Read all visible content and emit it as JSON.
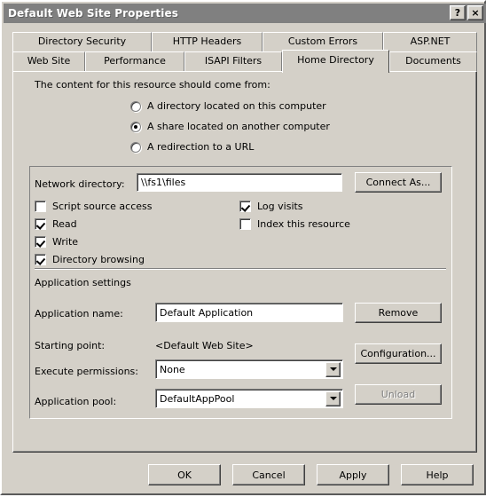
{
  "window": {
    "title": "Default Web Site Properties",
    "help_button": "?",
    "close_button": "×"
  },
  "tabs": {
    "row1": [
      {
        "label": "Directory Security",
        "active": false
      },
      {
        "label": "HTTP Headers",
        "active": false
      },
      {
        "label": "Custom Errors",
        "active": false
      },
      {
        "label": "ASP.NET",
        "active": false
      }
    ],
    "row2": [
      {
        "label": "Web Site",
        "active": false
      },
      {
        "label": "Performance",
        "active": false
      },
      {
        "label": "ISAPI Filters",
        "active": false
      },
      {
        "label": "Home Directory",
        "active": true
      },
      {
        "label": "Documents",
        "active": false
      }
    ]
  },
  "content": {
    "heading": "The content for this resource should come from:",
    "radios": [
      {
        "label": "A directory located on this computer",
        "checked": false
      },
      {
        "label": "A share located on another computer",
        "checked": true
      },
      {
        "label": "A redirection to a URL",
        "checked": false
      }
    ],
    "network_directory": {
      "label": "Network directory:",
      "value": "\\\\fs1\\files",
      "connect_as_button": "Connect As..."
    },
    "permissions_left": [
      {
        "label": "Script source access",
        "checked": false
      },
      {
        "label": "Read",
        "checked": true
      },
      {
        "label": "Write",
        "checked": true
      },
      {
        "label": "Directory browsing",
        "checked": true
      }
    ],
    "permissions_right": [
      {
        "label": "Log visits",
        "checked": true
      },
      {
        "label": "Index this resource",
        "checked": false
      }
    ],
    "application_settings": {
      "heading": "Application settings",
      "application_name": {
        "label": "Application name:",
        "value": "Default Application",
        "button": "Remove"
      },
      "starting_point": {
        "label": "Starting point:",
        "value": "<Default Web Site>"
      },
      "execute_permissions": {
        "label": "Execute permissions:",
        "value": "None",
        "button": "Configuration..."
      },
      "application_pool": {
        "label": "Application pool:",
        "value": "DefaultAppPool",
        "button": "Unload",
        "button_disabled": true
      }
    }
  },
  "footer": {
    "ok": "OK",
    "cancel": "Cancel",
    "apply": "Apply",
    "help": "Help"
  }
}
